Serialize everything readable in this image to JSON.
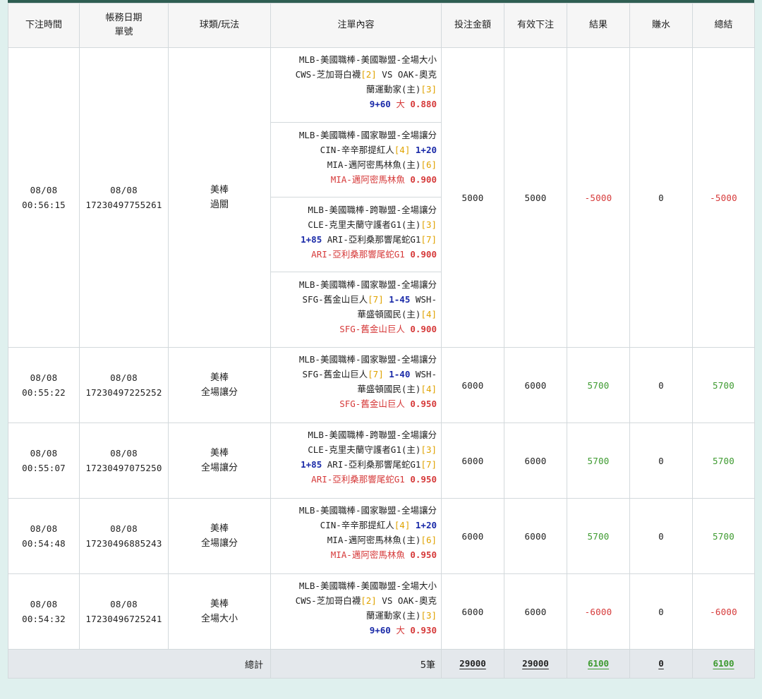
{
  "headers": {
    "time": "下注時間",
    "acct_line1": "帳務日期",
    "acct_line2": "單號",
    "sport": "球類/玩法",
    "content": "注單內容",
    "stake": "投注金額",
    "valid": "有效下注",
    "result": "結果",
    "rebate": "賺水",
    "total": "總結"
  },
  "rows": [
    {
      "date": "08/08",
      "time": "00:56:15",
      "acct_date": "08/08",
      "ticket": "17230497755261",
      "sport": "美棒",
      "play": "過關",
      "legs": [
        [
          [
            {
              "t": "MLB-美國職棒-美國聯盟-全場大小",
              "c": ""
            }
          ],
          [
            {
              "t": "CWS-芝加哥白襪",
              "c": ""
            },
            {
              "t": "[2]",
              "c": "rk"
            },
            {
              "t": " VS OAK-奧克",
              "c": ""
            }
          ],
          [
            {
              "t": "蘭運動家(主)",
              "c": ""
            },
            {
              "t": "[3]",
              "c": "rk"
            }
          ],
          [
            {
              "t": "9+60",
              "c": "hc"
            },
            {
              "t": " 大 ",
              "c": "red"
            },
            {
              "t": "0.880",
              "c": "oddsv"
            }
          ]
        ],
        [
          [
            {
              "t": "MLB-美國職棒-國家聯盟-全場讓分",
              "c": ""
            }
          ],
          [
            {
              "t": "CIN-辛辛那提紅人",
              "c": ""
            },
            {
              "t": "[4]",
              "c": "rk"
            },
            {
              "t": " ",
              "c": ""
            },
            {
              "t": "1+20",
              "c": "hc"
            }
          ],
          [
            {
              "t": "MIA-邁阿密馬林魚(主)",
              "c": ""
            },
            {
              "t": "[6]",
              "c": "rk"
            }
          ],
          [
            {
              "t": "MIA-邁阿密馬林魚 ",
              "c": "red"
            },
            {
              "t": "0.900",
              "c": "oddsv"
            }
          ]
        ],
        [
          [
            {
              "t": "MLB-美國職棒-跨聯盟-全場讓分",
              "c": ""
            }
          ],
          [
            {
              "t": "CLE-克里夫蘭守護者G1(主)",
              "c": ""
            },
            {
              "t": "[3]",
              "c": "rk"
            }
          ],
          [
            {
              "t": "1+85",
              "c": "hc"
            },
            {
              "t": " ARI-亞利桑那響尾蛇G1",
              "c": ""
            },
            {
              "t": "[7]",
              "c": "rk"
            }
          ],
          [
            {
              "t": "ARI-亞利桑那響尾蛇G1 ",
              "c": "red"
            },
            {
              "t": "0.900",
              "c": "oddsv"
            }
          ]
        ],
        [
          [
            {
              "t": "MLB-美國職棒-國家聯盟-全場讓分",
              "c": ""
            }
          ],
          [
            {
              "t": "SFG-舊金山巨人",
              "c": ""
            },
            {
              "t": "[7]",
              "c": "rk"
            },
            {
              "t": " ",
              "c": ""
            },
            {
              "t": "1-45",
              "c": "hc"
            },
            {
              "t": " WSH-",
              "c": ""
            }
          ],
          [
            {
              "t": "華盛頓國民(主)",
              "c": ""
            },
            {
              "t": "[4]",
              "c": "rk"
            }
          ],
          [
            {
              "t": "SFG-舊金山巨人 ",
              "c": "red"
            },
            {
              "t": "0.900",
              "c": "oddsv"
            }
          ]
        ]
      ],
      "stake": "5000",
      "valid": "5000",
      "result": "-5000",
      "rebate": "0",
      "total": "-5000",
      "result_sign": "neg"
    },
    {
      "date": "08/08",
      "time": "00:55:22",
      "acct_date": "08/08",
      "ticket": "17230497225252",
      "sport": "美棒",
      "play": "全場讓分",
      "legs": [
        [
          [
            {
              "t": "MLB-美國職棒-國家聯盟-全場讓分",
              "c": ""
            }
          ],
          [
            {
              "t": "SFG-舊金山巨人",
              "c": ""
            },
            {
              "t": "[7]",
              "c": "rk"
            },
            {
              "t": " ",
              "c": ""
            },
            {
              "t": "1-40",
              "c": "hc"
            },
            {
              "t": " WSH-",
              "c": ""
            }
          ],
          [
            {
              "t": "華盛頓國民(主)",
              "c": ""
            },
            {
              "t": "[4]",
              "c": "rk"
            }
          ],
          [
            {
              "t": "SFG-舊金山巨人 ",
              "c": "red"
            },
            {
              "t": "0.950",
              "c": "oddsv"
            }
          ]
        ]
      ],
      "stake": "6000",
      "valid": "6000",
      "result": "5700",
      "rebate": "0",
      "total": "5700",
      "result_sign": "pos"
    },
    {
      "date": "08/08",
      "time": "00:55:07",
      "acct_date": "08/08",
      "ticket": "17230497075250",
      "sport": "美棒",
      "play": "全場讓分",
      "legs": [
        [
          [
            {
              "t": "MLB-美國職棒-跨聯盟-全場讓分",
              "c": ""
            }
          ],
          [
            {
              "t": "CLE-克里夫蘭守護者G1(主)",
              "c": ""
            },
            {
              "t": "[3]",
              "c": "rk"
            }
          ],
          [
            {
              "t": "1+85",
              "c": "hc"
            },
            {
              "t": " ARI-亞利桑那響尾蛇G1",
              "c": ""
            },
            {
              "t": "[7]",
              "c": "rk"
            }
          ],
          [
            {
              "t": "ARI-亞利桑那響尾蛇G1 ",
              "c": "red"
            },
            {
              "t": "0.950",
              "c": "oddsv"
            }
          ]
        ]
      ],
      "stake": "6000",
      "valid": "6000",
      "result": "5700",
      "rebate": "0",
      "total": "5700",
      "result_sign": "pos"
    },
    {
      "date": "08/08",
      "time": "00:54:48",
      "acct_date": "08/08",
      "ticket": "17230496885243",
      "sport": "美棒",
      "play": "全場讓分",
      "legs": [
        [
          [
            {
              "t": "MLB-美國職棒-國家聯盟-全場讓分",
              "c": ""
            }
          ],
          [
            {
              "t": "CIN-辛辛那提紅人",
              "c": ""
            },
            {
              "t": "[4]",
              "c": "rk"
            },
            {
              "t": " ",
              "c": ""
            },
            {
              "t": "1+20",
              "c": "hc"
            }
          ],
          [
            {
              "t": "MIA-邁阿密馬林魚(主)",
              "c": ""
            },
            {
              "t": "[6]",
              "c": "rk"
            }
          ],
          [
            {
              "t": "MIA-邁阿密馬林魚 ",
              "c": "red"
            },
            {
              "t": "0.950",
              "c": "oddsv"
            }
          ]
        ]
      ],
      "stake": "6000",
      "valid": "6000",
      "result": "5700",
      "rebate": "0",
      "total": "5700",
      "result_sign": "pos"
    },
    {
      "date": "08/08",
      "time": "00:54:32",
      "acct_date": "08/08",
      "ticket": "17230496725241",
      "sport": "美棒",
      "play": "全場大小",
      "legs": [
        [
          [
            {
              "t": "MLB-美國職棒-美國聯盟-全場大小",
              "c": ""
            }
          ],
          [
            {
              "t": "CWS-芝加哥白襪",
              "c": ""
            },
            {
              "t": "[2]",
              "c": "rk"
            },
            {
              "t": " VS OAK-奧克",
              "c": ""
            }
          ],
          [
            {
              "t": "蘭運動家(主)",
              "c": ""
            },
            {
              "t": "[3]",
              "c": "rk"
            }
          ],
          [
            {
              "t": "9+60",
              "c": "hc"
            },
            {
              "t": " 大 ",
              "c": "red"
            },
            {
              "t": "0.930",
              "c": "oddsv"
            }
          ]
        ]
      ],
      "stake": "6000",
      "valid": "6000",
      "result": "-6000",
      "rebate": "0",
      "total": "-6000",
      "result_sign": "neg"
    }
  ],
  "totals": {
    "label": "總計",
    "count": "5筆",
    "stake": "29000",
    "valid": "29000",
    "result": "6100",
    "rebate": "0",
    "total": "6100"
  },
  "colors": {
    "rank": "#e0a300",
    "handicap": "#1a2aa8",
    "loss": "#d63a3a",
    "win": "#3d9a2f",
    "top_bar": "#2f5e52",
    "page_bg": "#dff0ee"
  }
}
